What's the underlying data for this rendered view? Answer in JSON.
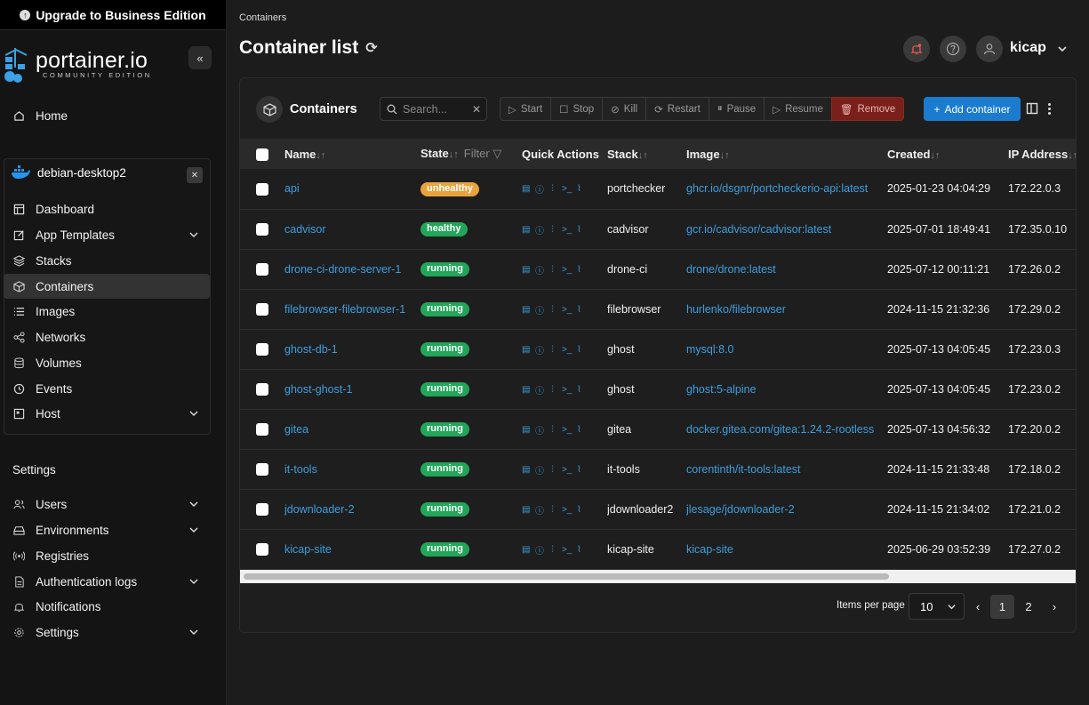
{
  "upgrade_label": "Upgrade to Business Edition",
  "logo": {
    "name": "portainer.io",
    "edition": "COMMUNITY EDITION"
  },
  "sidebar": {
    "home_label": "Home",
    "environment": {
      "name": "debian-desktop2",
      "items": [
        {
          "label": "Dashboard"
        },
        {
          "label": "App Templates"
        },
        {
          "label": "Stacks"
        },
        {
          "label": "Containers"
        },
        {
          "label": "Images"
        },
        {
          "label": "Networks"
        },
        {
          "label": "Volumes"
        },
        {
          "label": "Events"
        },
        {
          "label": "Host"
        }
      ]
    },
    "settings_title": "Settings",
    "settings_items": [
      {
        "label": "Users"
      },
      {
        "label": "Environments"
      },
      {
        "label": "Registries"
      },
      {
        "label": "Authentication logs"
      },
      {
        "label": "Notifications"
      },
      {
        "label": "Settings"
      }
    ]
  },
  "header": {
    "breadcrumb": "Containers",
    "title": "Container list",
    "username": "kicap"
  },
  "panel": {
    "title": "Containers",
    "search_placeholder": "Search...",
    "actions": {
      "start": "Start",
      "stop": "Stop",
      "kill": "Kill",
      "restart": "Restart",
      "pause": "Pause",
      "resume": "Resume",
      "remove": "Remove"
    },
    "add_label": "Add container"
  },
  "table": {
    "columns": {
      "name": "Name",
      "state": "State",
      "filter": "Filter",
      "quick_actions": "Quick Actions",
      "stack": "Stack",
      "image": "Image",
      "created": "Created",
      "ip": "IP Address"
    },
    "rows": [
      {
        "name": "api",
        "state": "unhealthy",
        "stack": "portchecker",
        "image": "ghcr.io/dsgnr/portcheckerio-api:latest",
        "created": "2025-01-23 04:04:29",
        "ip": "172.22.0.3"
      },
      {
        "name": "cadvisor",
        "state": "healthy",
        "stack": "cadvisor",
        "image": "gcr.io/cadvisor/cadvisor:latest",
        "created": "2025-07-01 18:49:41",
        "ip": "172.35.0.10"
      },
      {
        "name": "drone-ci-drone-server-1",
        "state": "running",
        "stack": "drone-ci",
        "image": "drone/drone:latest",
        "created": "2025-07-12 00:11:21",
        "ip": "172.26.0.2"
      },
      {
        "name": "filebrowser-filebrowser-1",
        "state": "running",
        "stack": "filebrowser",
        "image": "hurlenko/filebrowser",
        "created": "2024-11-15 21:32:36",
        "ip": "172.29.0.2"
      },
      {
        "name": "ghost-db-1",
        "state": "running",
        "stack": "ghost",
        "image": "mysql:8.0",
        "created": "2025-07-13 04:05:45",
        "ip": "172.23.0.3"
      },
      {
        "name": "ghost-ghost-1",
        "state": "running",
        "stack": "ghost",
        "image": "ghost:5-alpine",
        "created": "2025-07-13 04:05:45",
        "ip": "172.23.0.2"
      },
      {
        "name": "gitea",
        "state": "running",
        "stack": "gitea",
        "image": "docker.gitea.com/gitea:1.24.2-rootless",
        "created": "2025-07-13 04:56:32",
        "ip": "172.20.0.2"
      },
      {
        "name": "it-tools",
        "state": "running",
        "stack": "it-tools",
        "image": "corentinth/it-tools:latest",
        "created": "2024-11-15 21:33:48",
        "ip": "172.18.0.2"
      },
      {
        "name": "jdownloader-2",
        "state": "running",
        "stack": "jdownloader2",
        "image": "jlesage/jdownloader-2",
        "created": "2024-11-15 21:34:02",
        "ip": "172.21.0.2"
      },
      {
        "name": "kicap-site",
        "state": "running",
        "stack": "kicap-site",
        "image": "kicap-site",
        "created": "2025-06-29 03:52:39",
        "ip": "172.27.0.2"
      }
    ]
  },
  "pagination": {
    "items_per_page_label": "Items per page",
    "items_per_page": "10",
    "prev": "‹",
    "current": "1",
    "next_page": "2",
    "next": "›"
  },
  "colors": {
    "unhealthy": "#e8a33d",
    "healthy": "#23a55a",
    "running": "#23a55a",
    "accent": "#1b7ccf"
  }
}
